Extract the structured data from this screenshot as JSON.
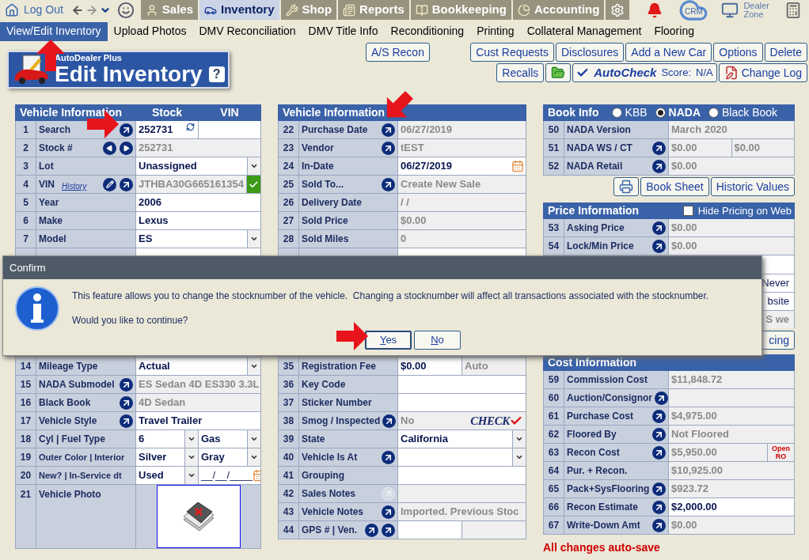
{
  "top_nav": {
    "logout": "Log Out",
    "tabs": [
      {
        "label": "Sales",
        "selected": false
      },
      {
        "label": "Inventory",
        "selected": true
      },
      {
        "label": "Shop",
        "selected": false
      },
      {
        "label": "Reports",
        "selected": false
      },
      {
        "label": "Bookkeeping",
        "selected": false
      },
      {
        "label": "Accounting",
        "selected": false
      }
    ],
    "crm": "CRM",
    "dealer_zone": "Dealer Zone"
  },
  "sub_nav": [
    {
      "label": "View/Edit Inventory",
      "selected": true
    },
    {
      "label": "Upload Photos",
      "selected": false
    },
    {
      "label": "DMV Reconciliation",
      "selected": false
    },
    {
      "label": "DMV Title Info",
      "selected": false
    },
    {
      "label": "Reconditioning",
      "selected": false
    },
    {
      "label": "Printing",
      "selected": false
    },
    {
      "label": "Collateral Management",
      "selected": false
    },
    {
      "label": "Flooring",
      "selected": false
    }
  ],
  "header": {
    "brand": "AutoDealer Plus",
    "title": "Edit Inventory",
    "help": "?"
  },
  "toolbar": {
    "recon": "A/S Recon",
    "row1": [
      "Cust Requests",
      "Disclosures",
      "Add a New Car",
      "Options",
      "Delete"
    ],
    "recalls": "Recalls",
    "autocheck": "AutoCheck",
    "score_label": "Score:",
    "score": "N/A",
    "change_log": "Change Log"
  },
  "left_panel": {
    "headers": [
      "Vehicle Information",
      "Stock",
      "VIN"
    ],
    "rows_top": [
      {
        "num": "1",
        "label": "Search",
        "icons": [
          {
            "kind": "go"
          }
        ],
        "values": [
          {
            "kind": "field",
            "text": "252731",
            "refresh": true
          },
          {
            "kind": "field"
          }
        ]
      },
      {
        "num": "2",
        "label": "Stock #",
        "icons": [
          {
            "kind": "prev"
          },
          {
            "kind": "next"
          }
        ],
        "values": [
          {
            "kind": "readonly",
            "text": "252731"
          }
        ]
      },
      {
        "num": "3",
        "label": "Lot",
        "values": [
          {
            "kind": "select",
            "text": "Unassigned"
          }
        ]
      },
      {
        "num": "4",
        "label": "VIN",
        "link": "History",
        "icons": [
          {
            "kind": "edit"
          },
          {
            "kind": "go"
          }
        ],
        "values": [
          {
            "kind": "readonly",
            "text": "JTHBA30G665161354",
            "verified": true
          }
        ]
      },
      {
        "num": "5",
        "label": "Year",
        "values": [
          {
            "kind": "field",
            "text": "2006"
          }
        ]
      },
      {
        "num": "6",
        "label": "Make",
        "values": [
          {
            "kind": "field",
            "text": "Lexus"
          }
        ]
      },
      {
        "num": "7",
        "label": "Model",
        "values": [
          {
            "kind": "select",
            "text": "ES"
          }
        ]
      }
    ],
    "rows_bottom": [
      {
        "num": "14",
        "label": "Mileage Type",
        "values": [
          {
            "kind": "select",
            "text": "Actual"
          }
        ]
      },
      {
        "num": "15",
        "label": "NADA Submodel",
        "icons": [
          {
            "kind": "go"
          }
        ],
        "values": [
          {
            "kind": "readonly",
            "text": "ES Sedan 4D ES330 3.3L"
          }
        ]
      },
      {
        "num": "16",
        "label": "Black Book",
        "icons": [
          {
            "kind": "go"
          }
        ],
        "values": [
          {
            "kind": "readonly",
            "text": "4D Sedan"
          }
        ]
      },
      {
        "num": "17",
        "label": "Vehicle Style",
        "icons": [
          {
            "kind": "go"
          }
        ],
        "values": [
          {
            "kind": "field",
            "text": "Travel Trailer"
          }
        ]
      },
      {
        "num": "18",
        "label": "Cyl | Fuel Type",
        "values": [
          {
            "kind": "select",
            "text": "6"
          },
          {
            "kind": "select",
            "text": "Gas"
          }
        ]
      },
      {
        "num": "19",
        "label": "Outer Color | Interior",
        "values": [
          {
            "kind": "select",
            "text": "Silver"
          },
          {
            "kind": "select",
            "text": "Gray"
          }
        ]
      },
      {
        "num": "20",
        "label": "New? | In-Service dt",
        "values": [
          {
            "kind": "select",
            "text": "Used"
          },
          {
            "kind": "date",
            "text": "__/__/____",
            "calendar": true
          }
        ]
      },
      {
        "num": "21",
        "label": "Vehicle Photo",
        "values": [
          {
            "kind": "photo"
          }
        ]
      }
    ]
  },
  "middle_panel": {
    "title": "Vehicle Information",
    "rows_top": [
      {
        "num": "22",
        "label": "Purchase Date",
        "icons": [
          {
            "kind": "go"
          }
        ],
        "values": [
          {
            "kind": "readonly",
            "text": "06/27/2019"
          }
        ]
      },
      {
        "num": "23",
        "label": "Vendor",
        "icons": [
          {
            "kind": "go"
          }
        ],
        "values": [
          {
            "kind": "readonly",
            "text": "tEST"
          }
        ]
      },
      {
        "num": "24",
        "label": "In-Date",
        "values": [
          {
            "kind": "field",
            "text": "06/27/2019",
            "calendar": true
          }
        ]
      },
      {
        "num": "25",
        "label": "Sold To...",
        "icons": [
          {
            "kind": "go"
          }
        ],
        "values": [
          {
            "kind": "readonly",
            "text": "Create New Sale"
          }
        ]
      },
      {
        "num": "26",
        "label": "Delivery Date",
        "values": [
          {
            "kind": "readonly",
            "text": "/ /"
          }
        ]
      },
      {
        "num": "27",
        "label": "Sold Price",
        "values": [
          {
            "kind": "readonly",
            "text": "$0.00"
          }
        ]
      },
      {
        "num": "28",
        "label": "Sold Miles",
        "values": [
          {
            "kind": "readonly",
            "text": "0"
          }
        ]
      }
    ],
    "rows_bottom": [
      {
        "num": "35",
        "label": "Registration Fee",
        "values": [
          {
            "kind": "field",
            "text": "$0.00"
          },
          {
            "kind": "readonly",
            "text": "Auto"
          }
        ]
      },
      {
        "num": "36",
        "label": "Key Code",
        "values": [
          {
            "kind": "field"
          }
        ]
      },
      {
        "num": "37",
        "label": "Sticker Number",
        "values": [
          {
            "kind": "field"
          }
        ]
      },
      {
        "num": "38",
        "label": "Smog / Inspected",
        "icons": [
          {
            "kind": "go"
          }
        ],
        "values": [
          {
            "kind": "readonly",
            "text": "No",
            "badge": "CHECK"
          }
        ]
      },
      {
        "num": "39",
        "label": "State",
        "values": [
          {
            "kind": "select",
            "text": "California"
          }
        ]
      },
      {
        "num": "40",
        "label": "Vehicle Is At",
        "icons": [
          {
            "kind": "go"
          }
        ],
        "values": [
          {
            "kind": "select"
          }
        ]
      },
      {
        "num": "41",
        "label": "Grouping",
        "values": [
          {
            "kind": "field"
          }
        ]
      },
      {
        "num": "42",
        "label": "Sales Notes",
        "icons": [
          {
            "kind": "inactive"
          }
        ],
        "values": [
          {
            "kind": "readonly"
          }
        ]
      },
      {
        "num": "43",
        "label": "Vehicle Notes",
        "icons": [
          {
            "kind": "go"
          }
        ],
        "values": [
          {
            "kind": "readonly",
            "text": "Imported. Previous Stoc"
          }
        ]
      },
      {
        "num": "44",
        "label": "GPS # | Ven.",
        "icons": [
          {
            "kind": "go"
          },
          {
            "kind": "go"
          }
        ],
        "values": [
          {
            "kind": "field"
          },
          {
            "kind": "readonly"
          }
        ]
      }
    ]
  },
  "book_info": {
    "title": "Book Info",
    "options": [
      {
        "label": "KBB",
        "selected": false
      },
      {
        "label": "NADA",
        "selected": true
      },
      {
        "label": "Black Book",
        "selected": false
      }
    ],
    "rows": [
      {
        "num": "50",
        "label": "NADA Version",
        "values": [
          {
            "kind": "readonly",
            "text": "March 2020"
          }
        ]
      },
      {
        "num": "51",
        "label": "NADA WS / CT",
        "icons": [
          {
            "kind": "go"
          }
        ],
        "values": [
          {
            "kind": "readonly",
            "text": "$0.00"
          },
          {
            "kind": "readonly",
            "text": "$0.00"
          }
        ]
      },
      {
        "num": "52",
        "label": "NADA Retail",
        "icons": [
          {
            "kind": "go"
          }
        ],
        "values": [
          {
            "kind": "readonly",
            "text": "$0.00"
          }
        ]
      }
    ],
    "buttons": [
      "Book Sheet",
      "Historic Values"
    ]
  },
  "price_info": {
    "title": "Price Information",
    "checkbox": {
      "label": "Hide Pricing on Web",
      "checked": false
    },
    "rows": [
      {
        "num": "53",
        "label": "Asking Price",
        "icons": [
          {
            "kind": "go"
          }
        ],
        "values": [
          {
            "kind": "readonly",
            "text": "$0.00"
          }
        ]
      },
      {
        "num": "54",
        "label": "Lock/Min Price",
        "icons": [
          {
            "kind": "go"
          }
        ],
        "values": [
          {
            "kind": "readonly",
            "text": "$0.00"
          }
        ]
      }
    ],
    "covered_rows": [
      {
        "kind": "field",
        "text": "Never"
      },
      {
        "kind": "field",
        "text": "bsite"
      },
      {
        "kind": "readonly",
        "text": "S we"
      }
    ],
    "button": "cing"
  },
  "cost_info": {
    "title": "Cost Information",
    "rows": [
      {
        "num": "59",
        "label": "Commission Cost",
        "values": [
          {
            "kind": "readonly",
            "text": "$11,848.72"
          }
        ]
      },
      {
        "num": "60",
        "label": "Auction/Consignor",
        "icons": [
          {
            "kind": "go"
          }
        ],
        "values": [
          {
            "kind": "readonly"
          }
        ]
      },
      {
        "num": "61",
        "label": "Purchase Cost",
        "icons": [
          {
            "kind": "go"
          }
        ],
        "values": [
          {
            "kind": "readonly",
            "text": "$4,975.00"
          }
        ]
      },
      {
        "num": "62",
        "label": "Floored By",
        "icons": [
          {
            "kind": "go"
          }
        ],
        "values": [
          {
            "kind": "readonly",
            "text": "Not Floored"
          }
        ]
      },
      {
        "num": "63",
        "label": "Recon Cost",
        "icons": [
          {
            "kind": "go"
          }
        ],
        "values": [
          {
            "kind": "readonly",
            "text": "$5,950.00",
            "note": "Open RO"
          }
        ]
      },
      {
        "num": "64",
        "label": "Pur. + Recon.",
        "values": [
          {
            "kind": "readonly",
            "text": "$10,925.00"
          }
        ]
      },
      {
        "num": "65",
        "label": "Pack+SysFlooring",
        "icons": [
          {
            "kind": "go"
          }
        ],
        "values": [
          {
            "kind": "readonly",
            "text": "$923.72"
          }
        ]
      },
      {
        "num": "66",
        "label": "Recon Estimate",
        "icons": [
          {
            "kind": "go"
          }
        ],
        "values": [
          {
            "kind": "field",
            "text": "$2,000.00"
          }
        ]
      },
      {
        "num": "67",
        "label": "Write-Down Amt",
        "icons": [
          {
            "kind": "go"
          }
        ],
        "values": [
          {
            "kind": "readonly",
            "text": "$0.00"
          }
        ]
      }
    ]
  },
  "footer": "All changes auto-save",
  "dialog": {
    "title": "Confirm",
    "message": "This feature allows you to change the stocknumber of the vehicle.  Changing a stocknumber will affect all transactions associated with the stocknumber.",
    "question": "Would you like to continue?",
    "buttons": [
      "Yes",
      "No"
    ]
  }
}
